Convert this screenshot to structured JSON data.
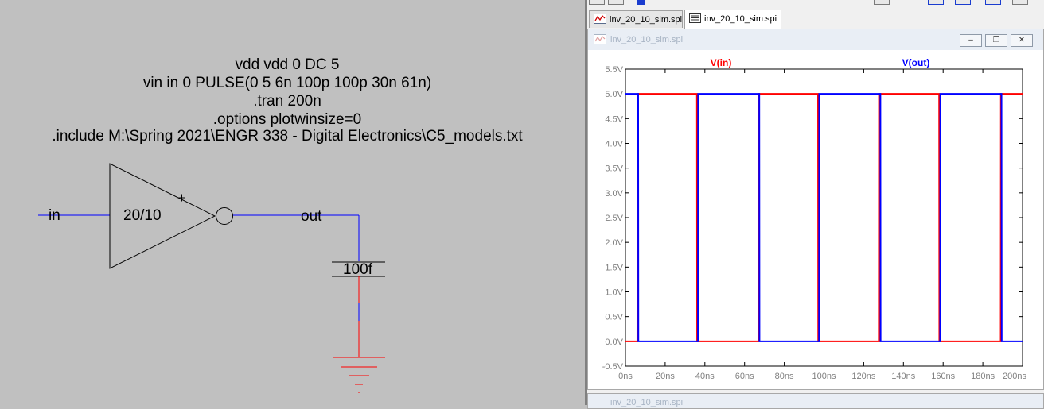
{
  "schematic": {
    "directives": [
      "vdd vdd 0 DC 5",
      "vin in 0 PULSE(0 5 6n 100p 100p 30n 61n)",
      ".tran 200n",
      ".options plotwinsize=0",
      ".include M:\\Spring 2021\\ENGR 338 - Digital Electronics\\C5_models.txt"
    ],
    "inverter_label": "20/10",
    "net_in": "in",
    "net_out": "out",
    "capacitor_value": "100f",
    "wire_color": "#0000ff",
    "component_color": "#000000",
    "ground_color": "#ff0000"
  },
  "tabs": [
    {
      "label": "inv_20_10_sim.spi",
      "icon": "waveform-icon",
      "active": false
    },
    {
      "label": "inv_20_10_sim.spi",
      "icon": "netlist-icon",
      "active": true
    }
  ],
  "waveform_window": {
    "title": "inv_20_10_sim.spi",
    "controls": [
      "minimize",
      "restore",
      "close"
    ]
  },
  "bottom_window": {
    "title": "inv_20_10_sim.spi"
  },
  "chart_data": {
    "type": "line",
    "series": [
      {
        "name": "V(in)",
        "color": "#ff0000",
        "x_ns": [
          0,
          6,
          6.1,
          36,
          36.1,
          67,
          67.1,
          97,
          97.1,
          128,
          128.1,
          158,
          158.1,
          189,
          189.1,
          200
        ],
        "y_v": [
          0,
          0,
          5,
          5,
          0,
          0,
          5,
          5,
          0,
          0,
          5,
          5,
          0,
          0,
          5,
          5
        ]
      },
      {
        "name": "V(out)",
        "color": "#0000ff",
        "x_ns": [
          0,
          6.4,
          6.5,
          36.5,
          36.6,
          67.4,
          67.5,
          97.5,
          97.6,
          128.4,
          128.5,
          158.5,
          158.6,
          189.4,
          189.5,
          200
        ],
        "y_v": [
          5,
          5,
          0,
          0,
          5,
          5,
          0,
          0,
          5,
          5,
          0,
          0,
          5,
          5,
          0,
          0
        ]
      }
    ],
    "x_ticks": [
      "0ns",
      "20ns",
      "40ns",
      "60ns",
      "80ns",
      "100ns",
      "120ns",
      "140ns",
      "160ns",
      "180ns",
      "200ns"
    ],
    "y_ticks": [
      "-0.5V",
      "0.0V",
      "0.5V",
      "1.0V",
      "1.5V",
      "2.0V",
      "2.5V",
      "3.0V",
      "3.5V",
      "4.0V",
      "4.5V",
      "5.0V",
      "5.5V"
    ],
    "xlim_ns": [
      0,
      200
    ],
    "ylim_v": [
      -0.5,
      5.5
    ],
    "grid": false,
    "legend": "top"
  }
}
